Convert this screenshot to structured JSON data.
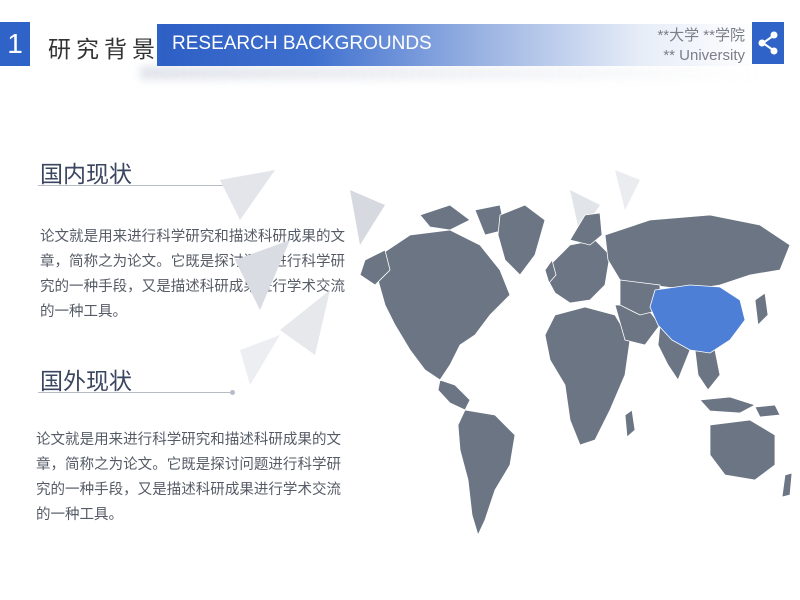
{
  "header": {
    "section_number": "1",
    "section_title": "研究背景",
    "banner_title": "RESEARCH BACKGROUNDS",
    "school_line": "**大学 **学院",
    "university_line": "** University"
  },
  "sections": [
    {
      "heading": "国内现状",
      "body": "论文就是用来进行科学研究和描述科研成果的文章，简称之为论文。它既是探讨问题进行科学研究的一种手段，又是描述科研成果进行学术交流的一种工具。"
    },
    {
      "heading": "国外现状",
      "body": "论文就是用来进行科学研究和描述科研成果的文章，简称之为论文。它既是探讨问题进行科学研究的一种手段，又是描述科研成果进行学术交流的一种工具。"
    }
  ],
  "map": {
    "land_color": "#6b7583",
    "highlight_color": "#4d7fd6",
    "highlight_region": "China",
    "icon": "share-icon"
  }
}
